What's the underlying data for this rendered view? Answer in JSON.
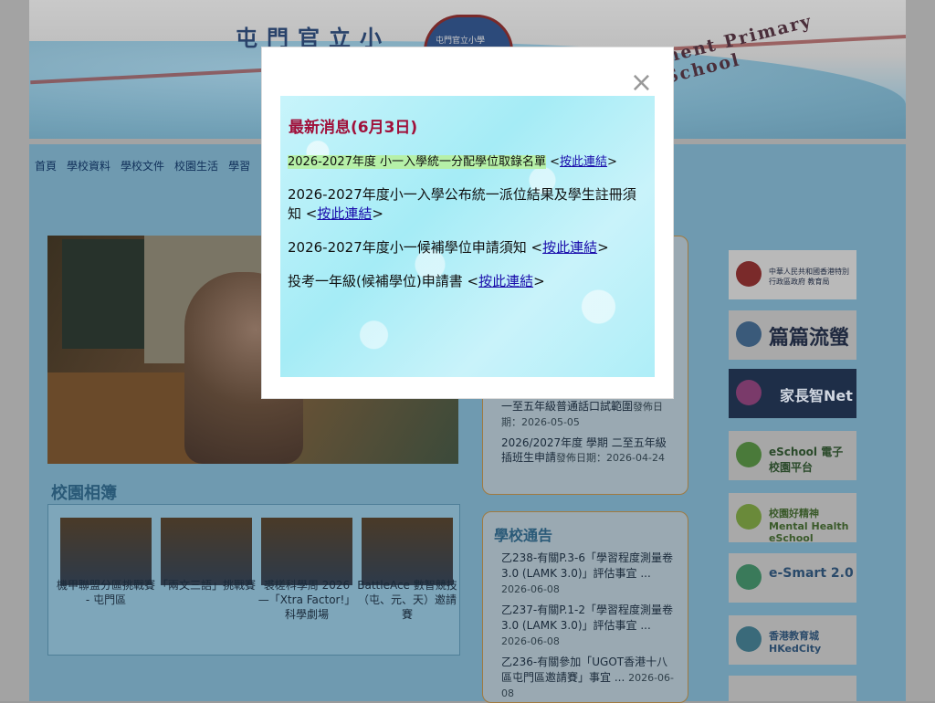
{
  "banner": {
    "title_cn": "屯門官立小",
    "title_en": "ment Primary School",
    "emblem_text": "屯門官立小學"
  },
  "nav": {
    "items": [
      "首頁",
      "學校資料",
      "學校文件",
      "校園生活",
      "學習"
    ]
  },
  "gallery": {
    "title": "校園相簿",
    "items": [
      {
        "caption": "機甲聯盟分區挑戰賽 - 屯門區"
      },
      {
        "caption": "「兩文三語」挑戰賽"
      },
      {
        "caption": "裘槎科學周 2026 —「Xtra Factor!」科學劇場"
      },
      {
        "caption": "BattleAce 數智競技（屯、元、天）邀請賽"
      }
    ]
  },
  "news": {
    "items": [
      {
        "title": "一至五年級普通話口試範圍",
        "meta": "發佈日期：2026-05-05"
      },
      {
        "title": "2026/2027年度 學期 二至五年級插班生申請",
        "meta": "發佈日期：2026-04-24"
      }
    ]
  },
  "notices": {
    "title": "學校通告",
    "items": [
      {
        "text": "乙238-有關P.3-6「學習程度測量卷3.0 (LAMK 3.0)」評估事宜 ...",
        "date": "2026-06-08"
      },
      {
        "text": "乙237-有關P.1-2「學習程度測量卷3.0 (LAMK 3.0)」評估事宜 ...",
        "date": "2026-06-08"
      },
      {
        "text": "乙236-有關參加「UGOT香港十八區屯門區邀請賽」事宜 ...",
        "date": "2026-06-08"
      }
    ]
  },
  "side_links": [
    {
      "label": "中華人民共和國香港特別行政區政府 教育局",
      "icon": "edb-logo-icon"
    },
    {
      "label": "篇篇流螢",
      "icon": "reading-logo-icon"
    },
    {
      "label": "家長智Net",
      "icon": "parent-net-logo-icon"
    },
    {
      "label": "eSchool 電子校園平台",
      "icon": "eschool-logo-icon"
    },
    {
      "label": "校園好精神 Mental Health eSchool",
      "icon": "mental-health-logo-icon"
    },
    {
      "label": "e-Smart 2.0",
      "icon": "esmart-logo-icon"
    },
    {
      "label": "香港教育城 HKedCity",
      "icon": "hkedcity-logo-icon"
    }
  ],
  "modal": {
    "close_label": "×",
    "title": "最新消息(6月3日)",
    "lines": [
      {
        "text": "2026-2027年度 小一入學統一分配學位取錄名單",
        "link": "按此連結"
      },
      {
        "text": "2026-2027年度小一入學公布統一派位結果及學生註冊須知",
        "link": "按此連結"
      },
      {
        "text": "2026-2027年度小一候補學位申請須知",
        "link": "按此連結"
      },
      {
        "text": "投考一年級(候補學位)申請書",
        "link": "按此連結"
      }
    ]
  }
}
